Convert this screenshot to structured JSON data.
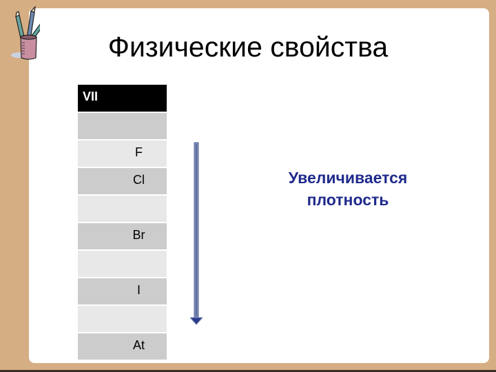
{
  "slide": {
    "title": "Физические свойства",
    "note": {
      "line1": "Увеличивается",
      "line2": "плотность"
    },
    "colors": {
      "background": "#d6ae84",
      "panel": "#ffffff",
      "note_text": "#1f2a8c",
      "arrow": "#7b8ab5",
      "header_row": "#000000",
      "row_dark": "#cccccc",
      "row_light": "#e8e8e8"
    }
  },
  "table": {
    "header": "VII",
    "rows": [
      {
        "text": "",
        "shade": "dark"
      },
      {
        "text": "F",
        "shade": "light"
      },
      {
        "text": "Cl",
        "shade": "dark"
      },
      {
        "text": "",
        "shade": "light"
      },
      {
        "text": "Br",
        "shade": "dark"
      },
      {
        "text": "",
        "shade": "light"
      },
      {
        "text": "I",
        "shade": "dark"
      },
      {
        "text": "",
        "shade": "light"
      },
      {
        "text": "At",
        "shade": "dark"
      }
    ]
  },
  "icons": {
    "decoration": "pencil-cup-icon",
    "direction": "arrow-down-icon"
  }
}
